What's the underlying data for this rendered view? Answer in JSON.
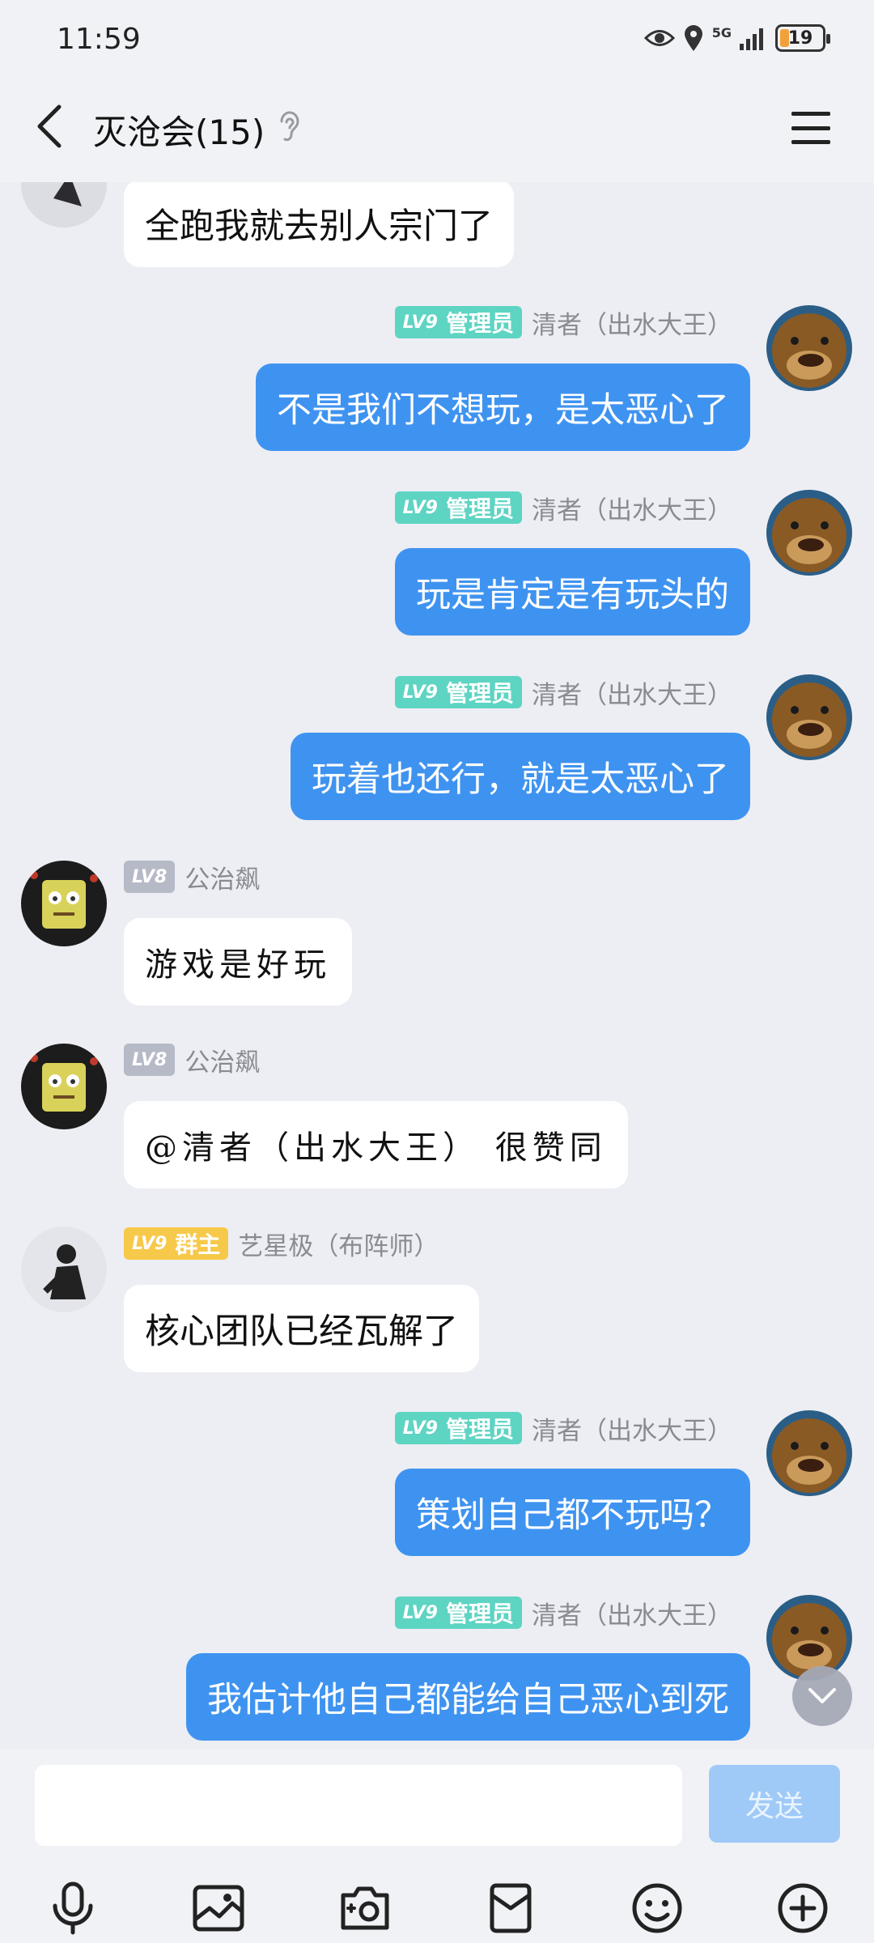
{
  "status_bar": {
    "time": "11:59",
    "network": "5G",
    "battery": "19"
  },
  "header": {
    "title": "灭沧会(15)"
  },
  "messages": [
    {
      "sender": "",
      "text": "全跑我就去别人宗门了"
    },
    {
      "sender": "清者（出水大王）",
      "badge_level": "LV9",
      "badge_role": "管理员",
      "text": "不是我们不想玩，是太恶心了"
    },
    {
      "sender": "清者（出水大王）",
      "badge_level": "LV9",
      "badge_role": "管理员",
      "text": "玩是肯定是有玩头的"
    },
    {
      "sender": "清者（出水大王）",
      "badge_level": "LV9",
      "badge_role": "管理员",
      "text": "玩着也还行，就是太恶心了"
    },
    {
      "sender": "公治飙",
      "badge_level": "LV8",
      "text": "游戏是好玩"
    },
    {
      "sender": "公治飙",
      "badge_level": "LV8",
      "text": "@清者（出水大王） 很赞同"
    },
    {
      "sender": "艺星极（布阵师）",
      "badge_level": "LV9",
      "badge_role": "群主",
      "text": "核心团队已经瓦解了"
    },
    {
      "sender": "清者（出水大王）",
      "badge_level": "LV9",
      "badge_role": "管理员",
      "text": "策划自己都不玩吗？"
    },
    {
      "sender": "清者（出水大王）",
      "badge_level": "LV9",
      "badge_role": "管理员",
      "text": "我估计他自己都能给自己恶心到死"
    }
  ],
  "input": {
    "placeholder": "",
    "send_label": "发送"
  },
  "toolbar": [
    "microphone-icon",
    "image-icon",
    "camera-icon",
    "red-packet-icon",
    "emoji-icon",
    "plus-icon"
  ],
  "colors": {
    "outgoing_bubble": "#3f93f0",
    "incoming_bubble": "#ffffff",
    "admin_badge": "#5ed4c3",
    "owner_badge": "#f7c94a",
    "lv8_badge": "#b6bac7",
    "send_button": "#9fcaf8"
  }
}
